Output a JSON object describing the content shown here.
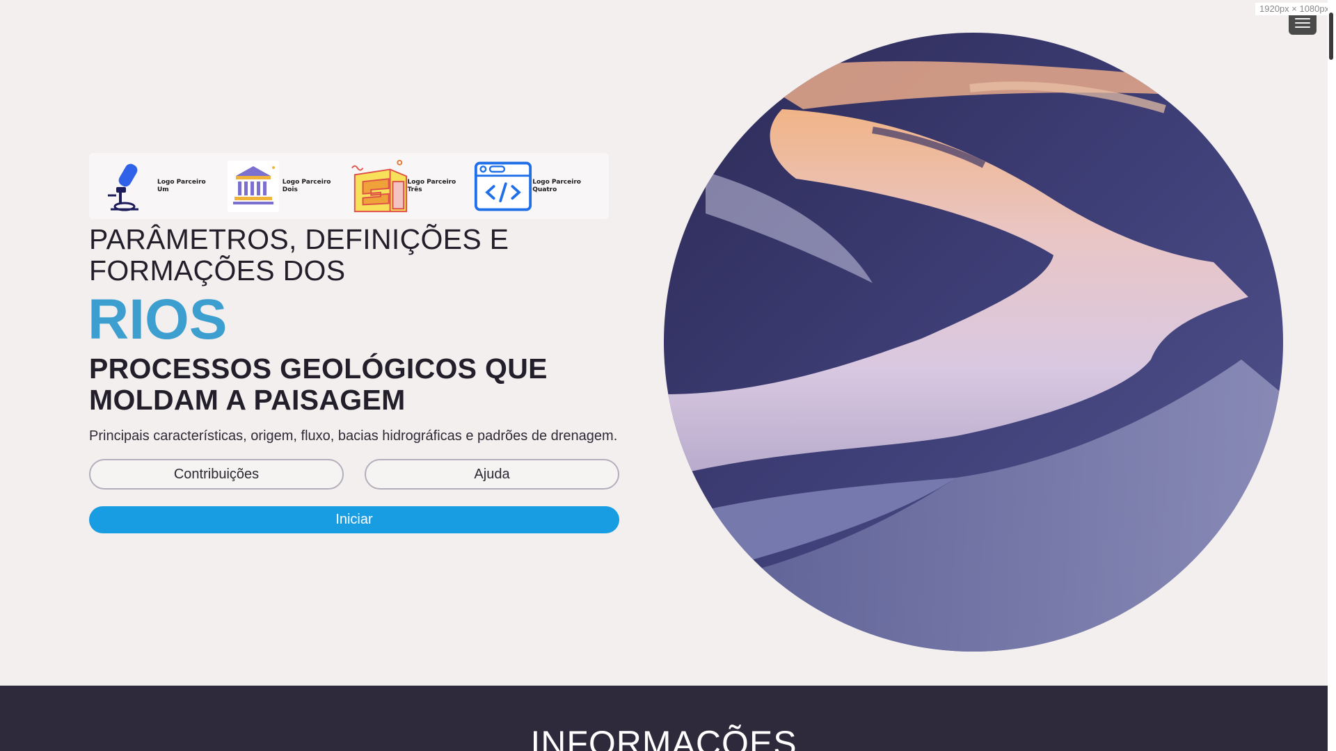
{
  "partners": [
    {
      "label": "Logo Parceiro Um",
      "icon": "microscope-icon"
    },
    {
      "label": "Logo Parceiro Dois",
      "icon": "bank-building-icon"
    },
    {
      "label": "Logo Parceiro Três",
      "icon": "building-blocks-icon"
    },
    {
      "label": "Logo Parceiro Quatro",
      "icon": "code-window-icon"
    }
  ],
  "hero": {
    "headline": "PARÂMETROS, DEFINIÇÕES E FORMAÇÕES DOS",
    "highlight": "RIOS",
    "subheadline": "PROCESSOS GEOLÓGICOS QUE MOLDAM A PAISAGEM",
    "description": "Principais características, origem, fluxo, bacias hidrográficas e padrões de drenagem.",
    "buttons": {
      "contributions": "Contribuições",
      "help": "Ajuda",
      "start": "Iniciar"
    }
  },
  "info_section": {
    "title": "INFORMAÇÕES"
  },
  "viewport_label": "1920px × 1080px",
  "colors": {
    "background": "#f3efef",
    "accent_blue": "#189de2",
    "highlight_text": "#3d9fcf",
    "info_band": "#2f2a3b"
  }
}
